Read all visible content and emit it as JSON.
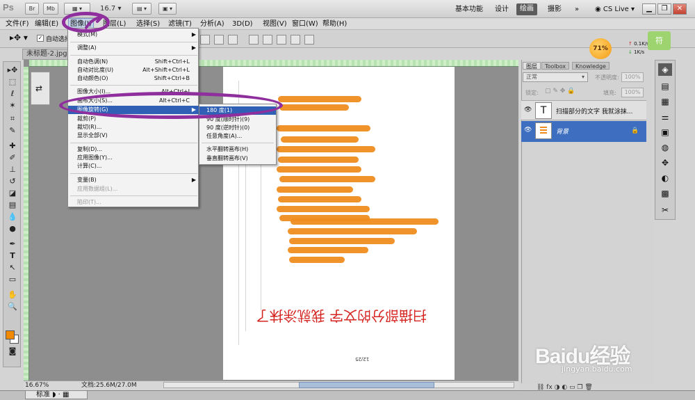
{
  "appbar": {
    "logo": "Ps",
    "buttons": [
      "Br",
      "Mb"
    ],
    "zoom": "16.7",
    "workspaces": [
      "基本功能",
      "设计",
      "绘画",
      "摄影"
    ],
    "active_workspace": "绘画",
    "cs_live": "CS Live"
  },
  "menubar": {
    "items": [
      "文件(F)",
      "编辑(E)",
      "图像(I)",
      "图层(L)",
      "选择(S)",
      "滤镜(T)",
      "分析(A)",
      "3D(D)",
      "视图(V)",
      "窗口(W)",
      "帮助(H)"
    ]
  },
  "options": {
    "auto_select_label": "自动选择"
  },
  "doc": {
    "tab_title": "未标题-2.jpg",
    "flipped_text": "扫描部分的文字 我就涂抹了",
    "page_number": "12/25"
  },
  "status": {
    "zoom": "16.67%",
    "doc_size": "文档:25.6M/27.0M"
  },
  "ime": {
    "mode": "标准"
  },
  "image_menu": {
    "items": [
      {
        "label": "模式(M)",
        "arrow": true
      },
      {
        "label": "调整(A)",
        "arrow": true
      },
      {
        "label": "自动色调(N)",
        "shortcut": "Shift+Ctrl+L"
      },
      {
        "label": "自动对比度(U)",
        "shortcut": "Alt+Shift+Ctrl+L"
      },
      {
        "label": "自动颜色(O)",
        "shortcut": "Shift+Ctrl+B"
      },
      {
        "label": "图像大小(I)...",
        "shortcut": "Alt+Ctrl+I"
      },
      {
        "label": "画布大小(S)...",
        "shortcut": "Alt+Ctrl+C"
      },
      {
        "label": "图像旋转(G)",
        "arrow": true,
        "active": true
      },
      {
        "label": "裁剪(P)"
      },
      {
        "label": "裁切(R)..."
      },
      {
        "label": "显示全部(V)"
      },
      {
        "label": "复制(D)..."
      },
      {
        "label": "应用图像(Y)..."
      },
      {
        "label": "计算(C)..."
      },
      {
        "label": "变量(B)",
        "arrow": true
      },
      {
        "label": "应用数据组(L)...",
        "disabled": true
      },
      {
        "label": "陷印(T)...",
        "disabled": true
      }
    ]
  },
  "rotate_submenu": {
    "items": [
      {
        "label": "180 度(1)",
        "active": true
      },
      {
        "label": "90 度(顺时针)(9)"
      },
      {
        "label": "90 度(逆时针)(0)"
      },
      {
        "label": "任意角度(A)..."
      },
      {
        "label": "水平翻转画布(H)"
      },
      {
        "label": "垂直翻转画布(V)"
      }
    ]
  },
  "layers_panel": {
    "tabs": [
      "图层",
      "Toolbox",
      "Knowledge"
    ],
    "blend_mode": "正常",
    "opacity_label": "不透明度:",
    "opacity_value": "100%",
    "lock_label": "锁定:",
    "fill_label": "填充:",
    "fill_value": "100%",
    "layers": [
      {
        "name": "扫描部分的文字 我就涂抹...",
        "thumb": "T"
      },
      {
        "name": "背景",
        "selected": true
      }
    ]
  },
  "widget": {
    "percent": "71%",
    "upload": "0.1K/s",
    "download": "1K/s",
    "badge": "符"
  },
  "watermark": {
    "logo": "Baidu经验",
    "url": "jingyan.baidu.com"
  }
}
